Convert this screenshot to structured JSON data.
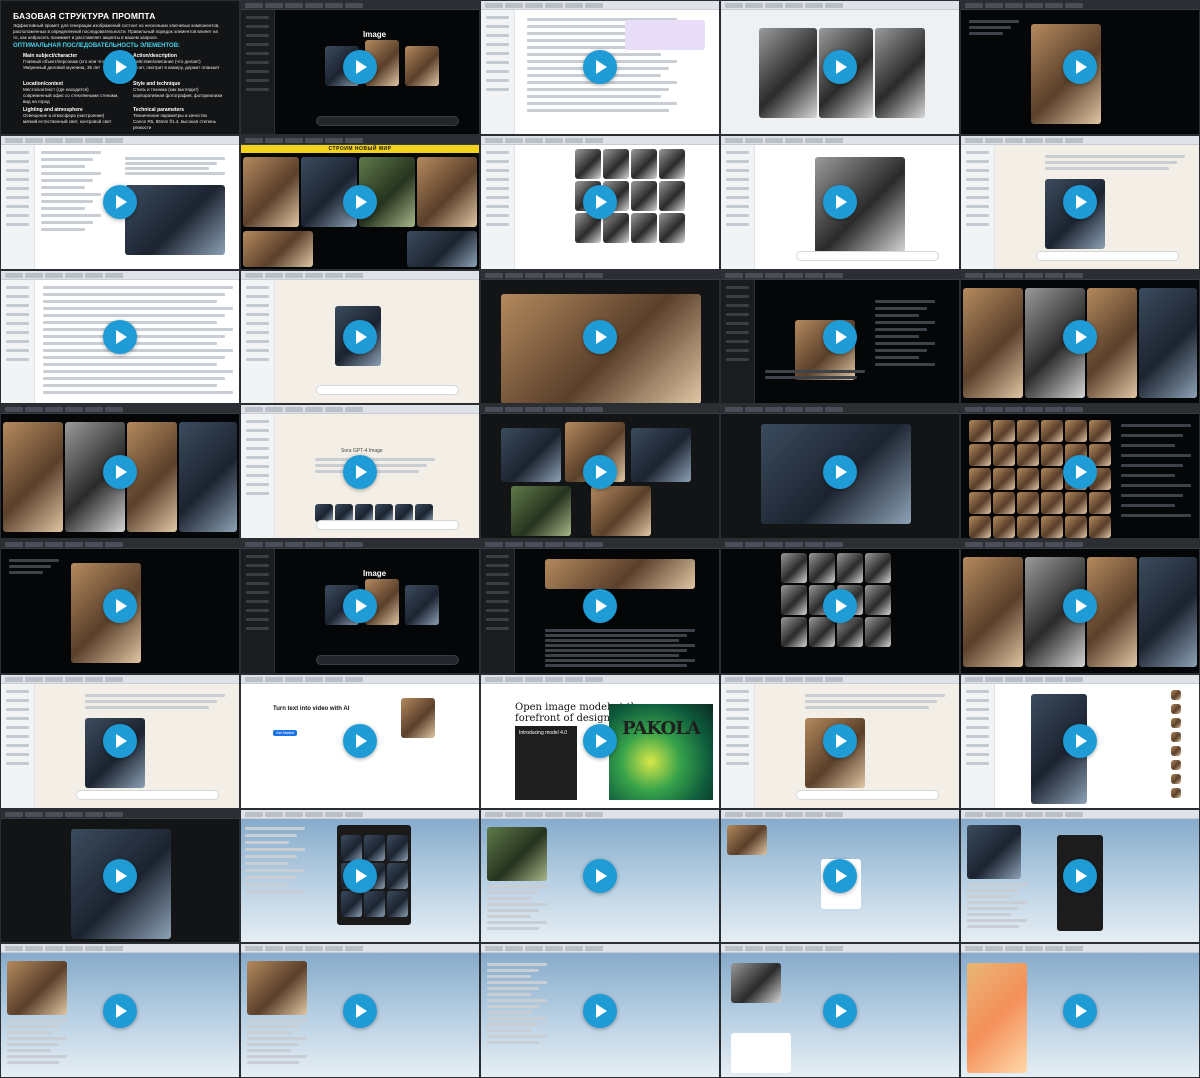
{
  "colors": {
    "play_button": "#1f9bd6",
    "slide_accent": "#46d2e8",
    "banner_yellow": "#f2d21b"
  },
  "slide": {
    "title": "БАЗОВАЯ СТРУКТУРА ПРОМПТА",
    "intro": "Эффективный промпт для генерации изображений состоит из нескольких ключевых компонентов, расположенных в определенной последовательности. Правильный порядок элементов влияет на то, как нейросеть понимает и расставляет акценты в вашем запросе.",
    "subtitle": "ОПТИМАЛЬНАЯ ПОСЛЕДОВАТЕЛЬНОСТЬ ЭЛЕМЕНТОВ:",
    "blocks": [
      {
        "heading": "Main subject/character",
        "lines": [
          "Главный объект/персонаж (кто или что)",
          "Уверенный деловой мужчина, 35 лет"
        ]
      },
      {
        "heading": "Action/description",
        "lines": [
          "Действие/описание (что делает)",
          "стоит, смотрит в камеру, держит планшет"
        ]
      },
      {
        "heading": "Location/context",
        "lines": [
          "Место/контекст (где находится)",
          "современный офис со стеклянными стенами, вид на город"
        ]
      },
      {
        "heading": "Style and technique",
        "lines": [
          "Стиль и техника (как выглядит)",
          "корпоративная фотография, фотореализм"
        ]
      },
      {
        "heading": "Lighting and atmosphere",
        "lines": [
          "Освещение и атмосфера (настроение)",
          "мягкий естественный свет, контровой свет"
        ]
      },
      {
        "heading": "Technical parameters",
        "lines": [
          "Технические параметры и качество",
          "Canon R5, 85mm f/1.4, высокая степень резкости"
        ]
      }
    ]
  },
  "tiles": {
    "image_logo": "Image",
    "banner": "СТРОИМ НОВЫЙ МИР",
    "chat_label": "Sora GPT-4 Image",
    "hero_left": "Turn text into video with AI",
    "hero_left_cta": "Get Started",
    "hero_right": "Open image model at the forefront of design",
    "intro_card": "Introducing model 4.0",
    "poster_text": "PAKOLA"
  },
  "video_grid": {
    "count": 40,
    "play_icon": "play-icon"
  }
}
